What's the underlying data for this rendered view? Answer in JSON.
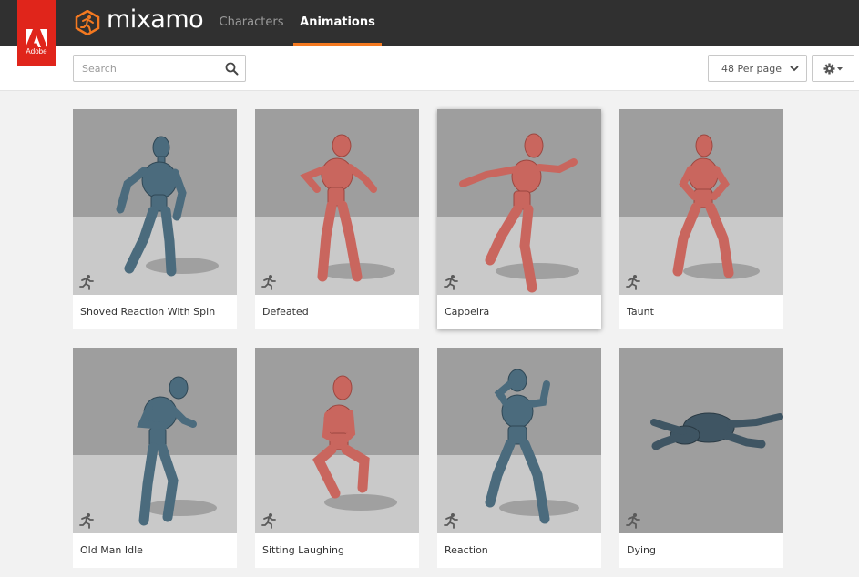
{
  "brand": {
    "adobe_label": "Adobe",
    "app_name": "mixamo",
    "accent_color": "#f47920",
    "adobe_red": "#e0251b"
  },
  "nav": {
    "tabs": [
      {
        "label": "Characters",
        "active": false
      },
      {
        "label": "Animations",
        "active": true
      }
    ]
  },
  "toolbar": {
    "search_placeholder": "Search",
    "search_value": "",
    "per_page_selected": "48 Per page",
    "settings_icon": "gear-icon"
  },
  "animations": [
    {
      "label": "Shoved Reaction With Spin",
      "figure_color": "#4b6b7d",
      "selected": false
    },
    {
      "label": "Defeated",
      "figure_color": "#c9665e",
      "selected": false
    },
    {
      "label": "Capoeira",
      "figure_color": "#c9665e",
      "selected": true
    },
    {
      "label": "Taunt",
      "figure_color": "#c9665e",
      "selected": false
    },
    {
      "label": "Old Man Idle",
      "figure_color": "#4b6b7d",
      "selected": false
    },
    {
      "label": "Sitting Laughing",
      "figure_color": "#c9665e",
      "selected": false
    },
    {
      "label": "Reaction",
      "figure_color": "#4b6b7d",
      "selected": false
    },
    {
      "label": "Dying",
      "figure_color": "#3f5563",
      "selected": false
    }
  ]
}
